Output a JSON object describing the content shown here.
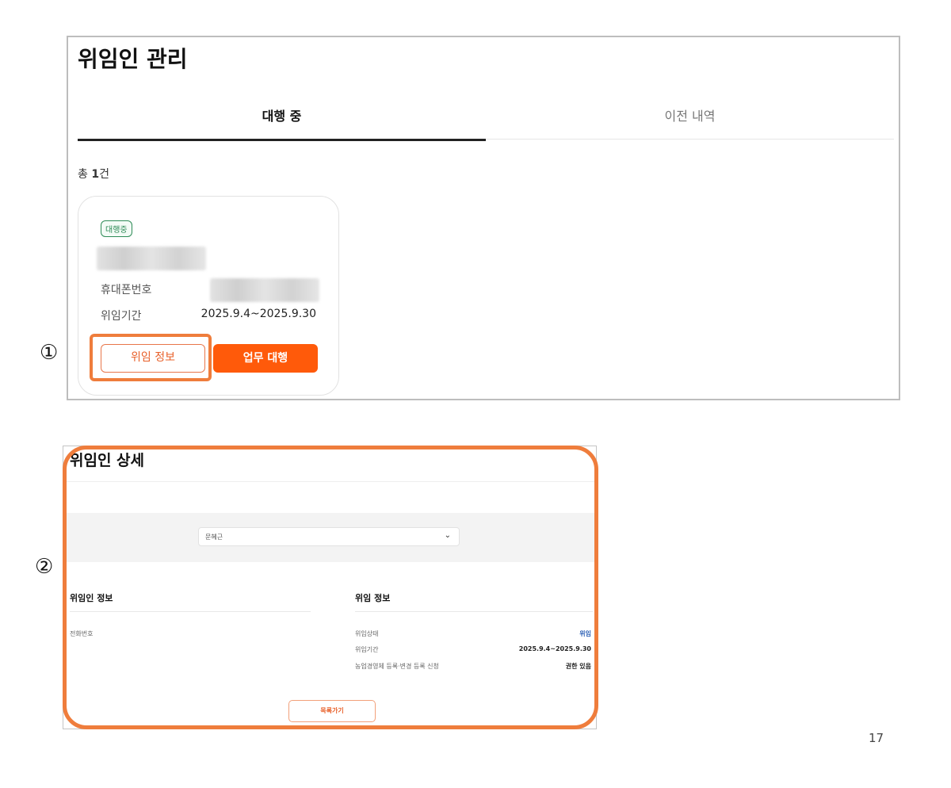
{
  "list_screen": {
    "title": "위임인 관리",
    "tabs": [
      {
        "label": "대행 중",
        "active": true
      },
      {
        "label": "이전 내역",
        "active": false
      }
    ],
    "count_prefix": "총 ",
    "count_value": "1",
    "count_suffix": "건",
    "card": {
      "badge": "대행중",
      "phone_label": "휴대폰번호",
      "period_label": "위임기간",
      "period_value": "2025.9.4~2025.9.30",
      "btn_info": "위임 정보",
      "btn_act": "업무 대행"
    }
  },
  "detail_screen": {
    "title": "위임인 상세",
    "select_value": "문혜근",
    "left_section": {
      "title": "위임인 정보",
      "phone_label": "전화번호"
    },
    "right_section": {
      "title": "위임 정보",
      "rows": [
        {
          "label": "위임상태",
          "value": "위임"
        },
        {
          "label": "위임기간",
          "value": "2025.9.4~2025.9.30"
        },
        {
          "label": "농업경영체 등록·변경 등록 신청",
          "value": "권한 있음"
        }
      ]
    },
    "back_button": "목록가기"
  },
  "annotations": {
    "marker_1": "①",
    "marker_2": "②",
    "highlight_color": "#ef7d3c"
  },
  "page_number": "17",
  "colors": {
    "accent": "#ff5a0a",
    "badge_green": "#2e8b57",
    "status_blue": "#2b5fb4"
  }
}
